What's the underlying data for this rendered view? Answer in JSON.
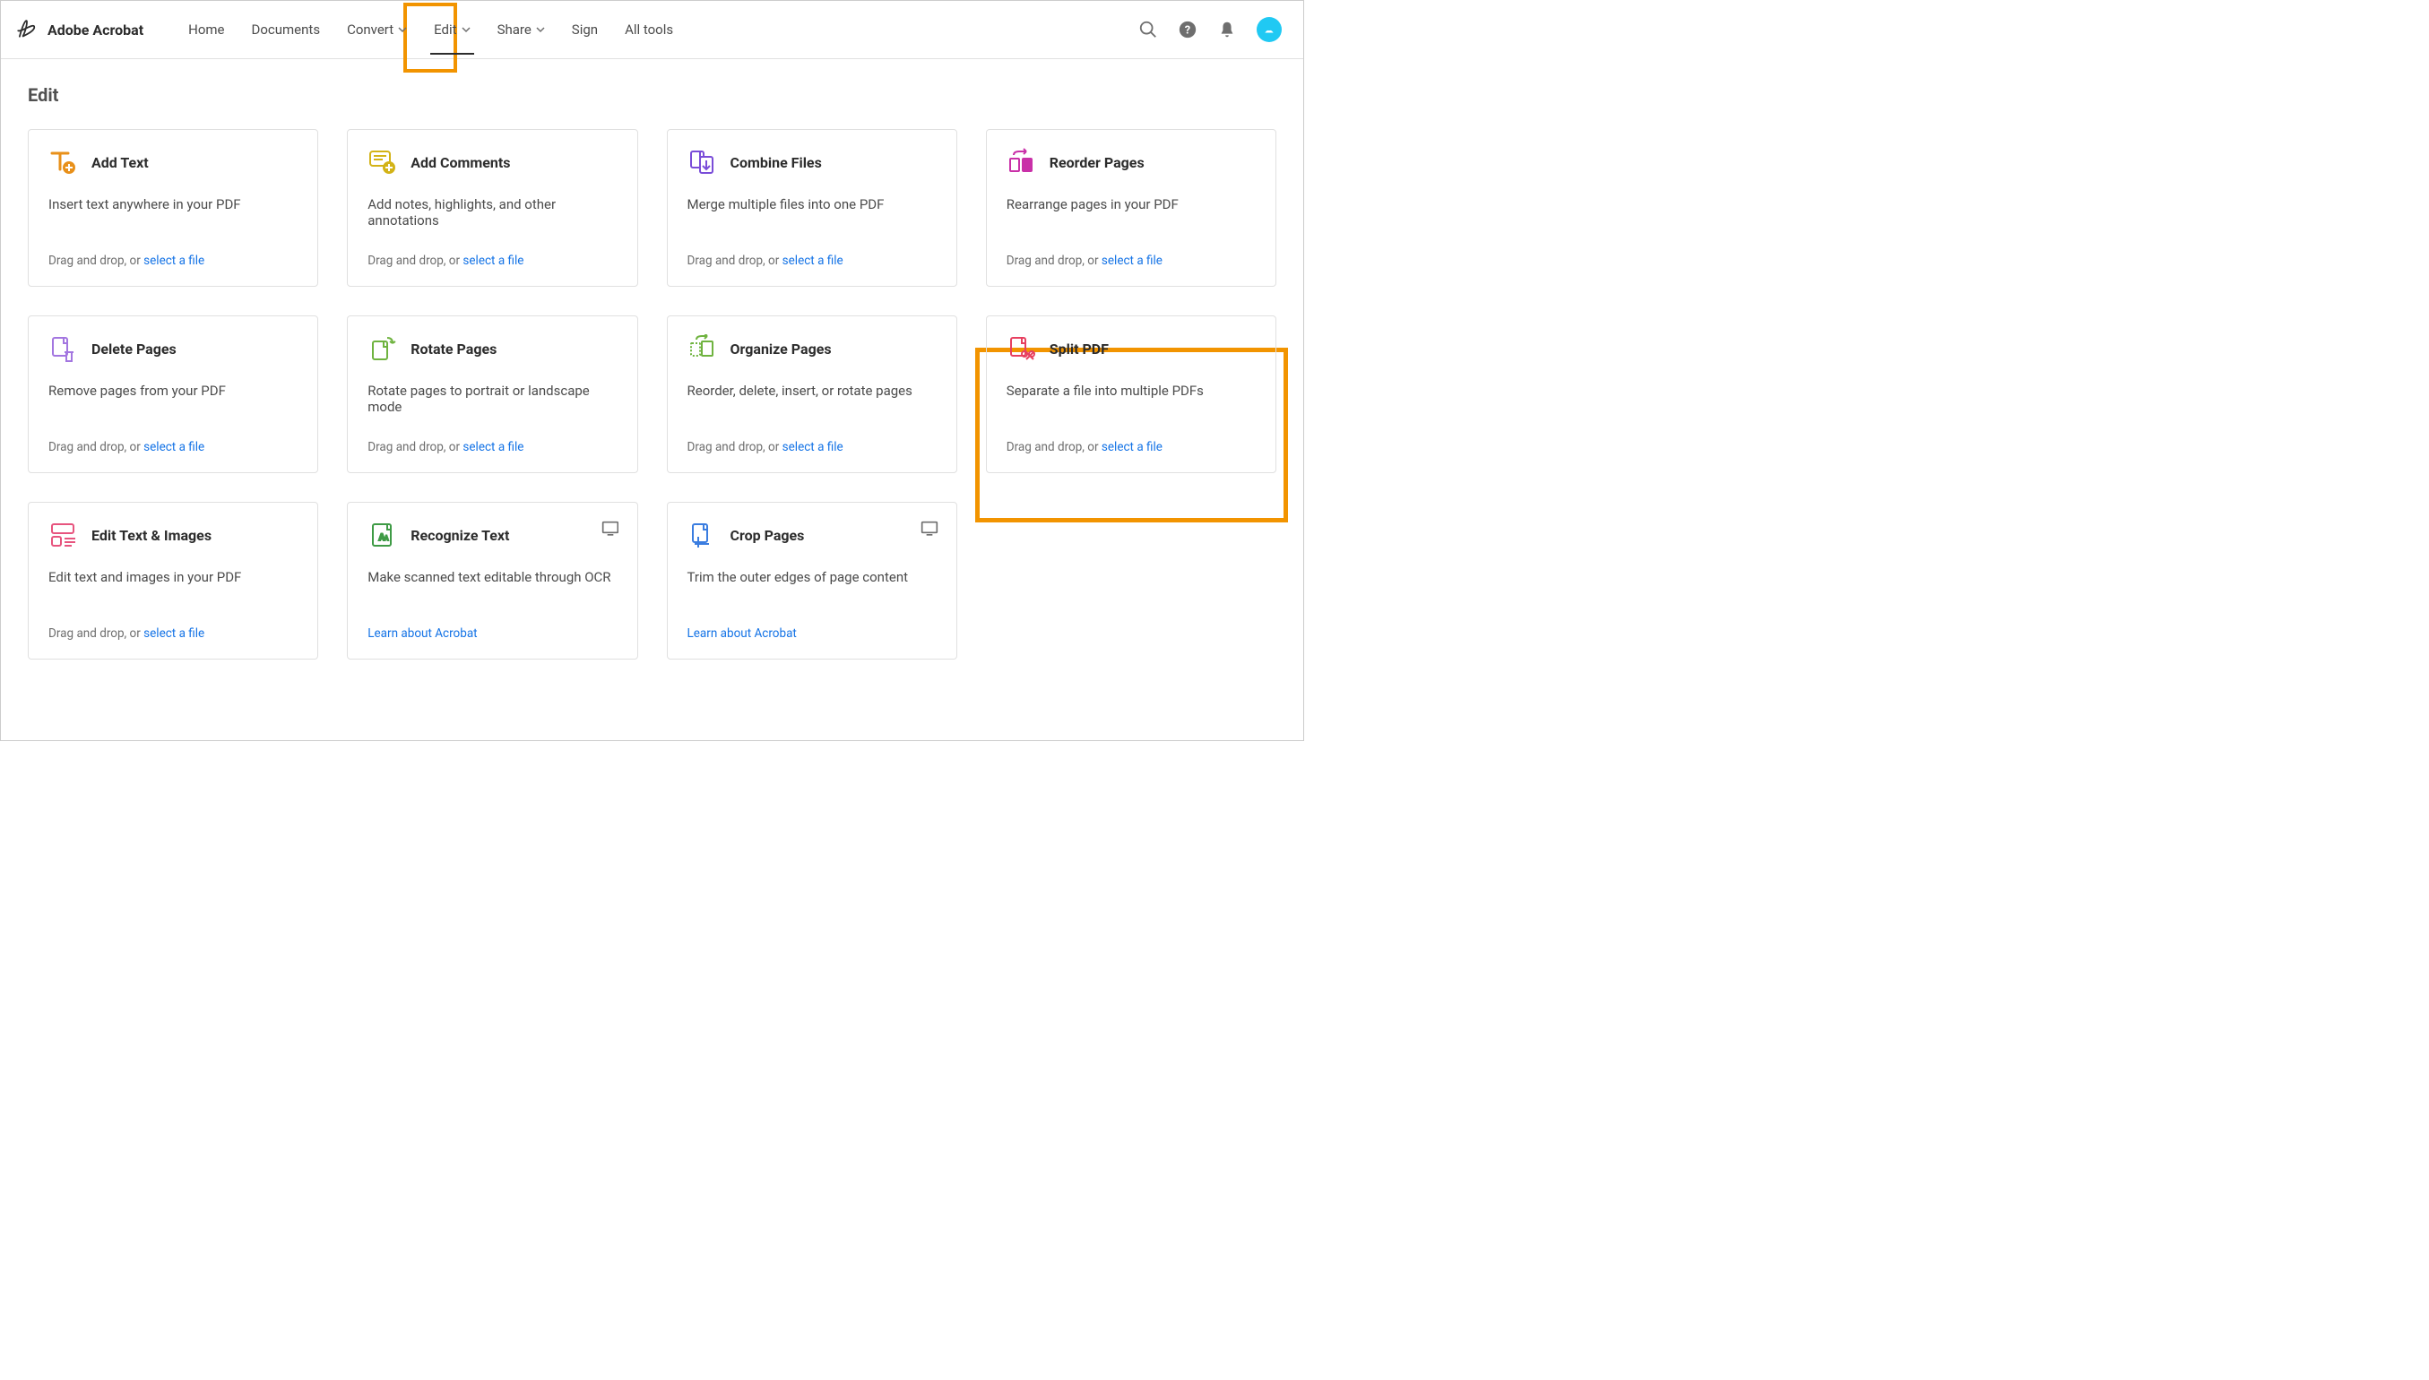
{
  "brand": {
    "name": "Adobe Acrobat"
  },
  "nav": {
    "items": [
      {
        "label": "Home",
        "chevron": false
      },
      {
        "label": "Documents",
        "chevron": false
      },
      {
        "label": "Convert",
        "chevron": true
      },
      {
        "label": "Edit",
        "chevron": true,
        "active": true
      },
      {
        "label": "Share",
        "chevron": true
      },
      {
        "label": "Sign",
        "chevron": false
      },
      {
        "label": "All tools",
        "chevron": false
      }
    ]
  },
  "page": {
    "title": "Edit"
  },
  "footer_text": {
    "drag": "Drag and drop, or ",
    "select": "select a file",
    "learn": "Learn about Acrobat"
  },
  "cards": [
    {
      "title": "Add Text",
      "desc": "Insert text anywhere in your PDF",
      "footer": "drag"
    },
    {
      "title": "Add Comments",
      "desc": "Add notes, highlights, and other annotations",
      "footer": "drag"
    },
    {
      "title": "Combine Files",
      "desc": "Merge multiple files into one PDF",
      "footer": "drag"
    },
    {
      "title": "Reorder Pages",
      "desc": "Rearrange pages in your PDF",
      "footer": "drag"
    },
    {
      "title": "Delete Pages",
      "desc": "Remove pages from your PDF",
      "footer": "drag"
    },
    {
      "title": "Rotate Pages",
      "desc": "Rotate pages to portrait or landscape mode",
      "footer": "drag"
    },
    {
      "title": "Organize Pages",
      "desc": "Reorder, delete, insert, or rotate pages",
      "footer": "drag"
    },
    {
      "title": "Split PDF",
      "desc": "Separate a file into multiple PDFs",
      "footer": "drag",
      "highlighted": true
    },
    {
      "title": "Edit Text & Images",
      "desc": "Edit text and images in your PDF",
      "footer": "drag"
    },
    {
      "title": "Recognize Text",
      "desc": "Make scanned text editable through OCR",
      "footer": "learn",
      "desktop": true
    },
    {
      "title": "Crop Pages",
      "desc": "Trim the outer edges of page content",
      "footer": "learn",
      "desktop": true
    }
  ]
}
